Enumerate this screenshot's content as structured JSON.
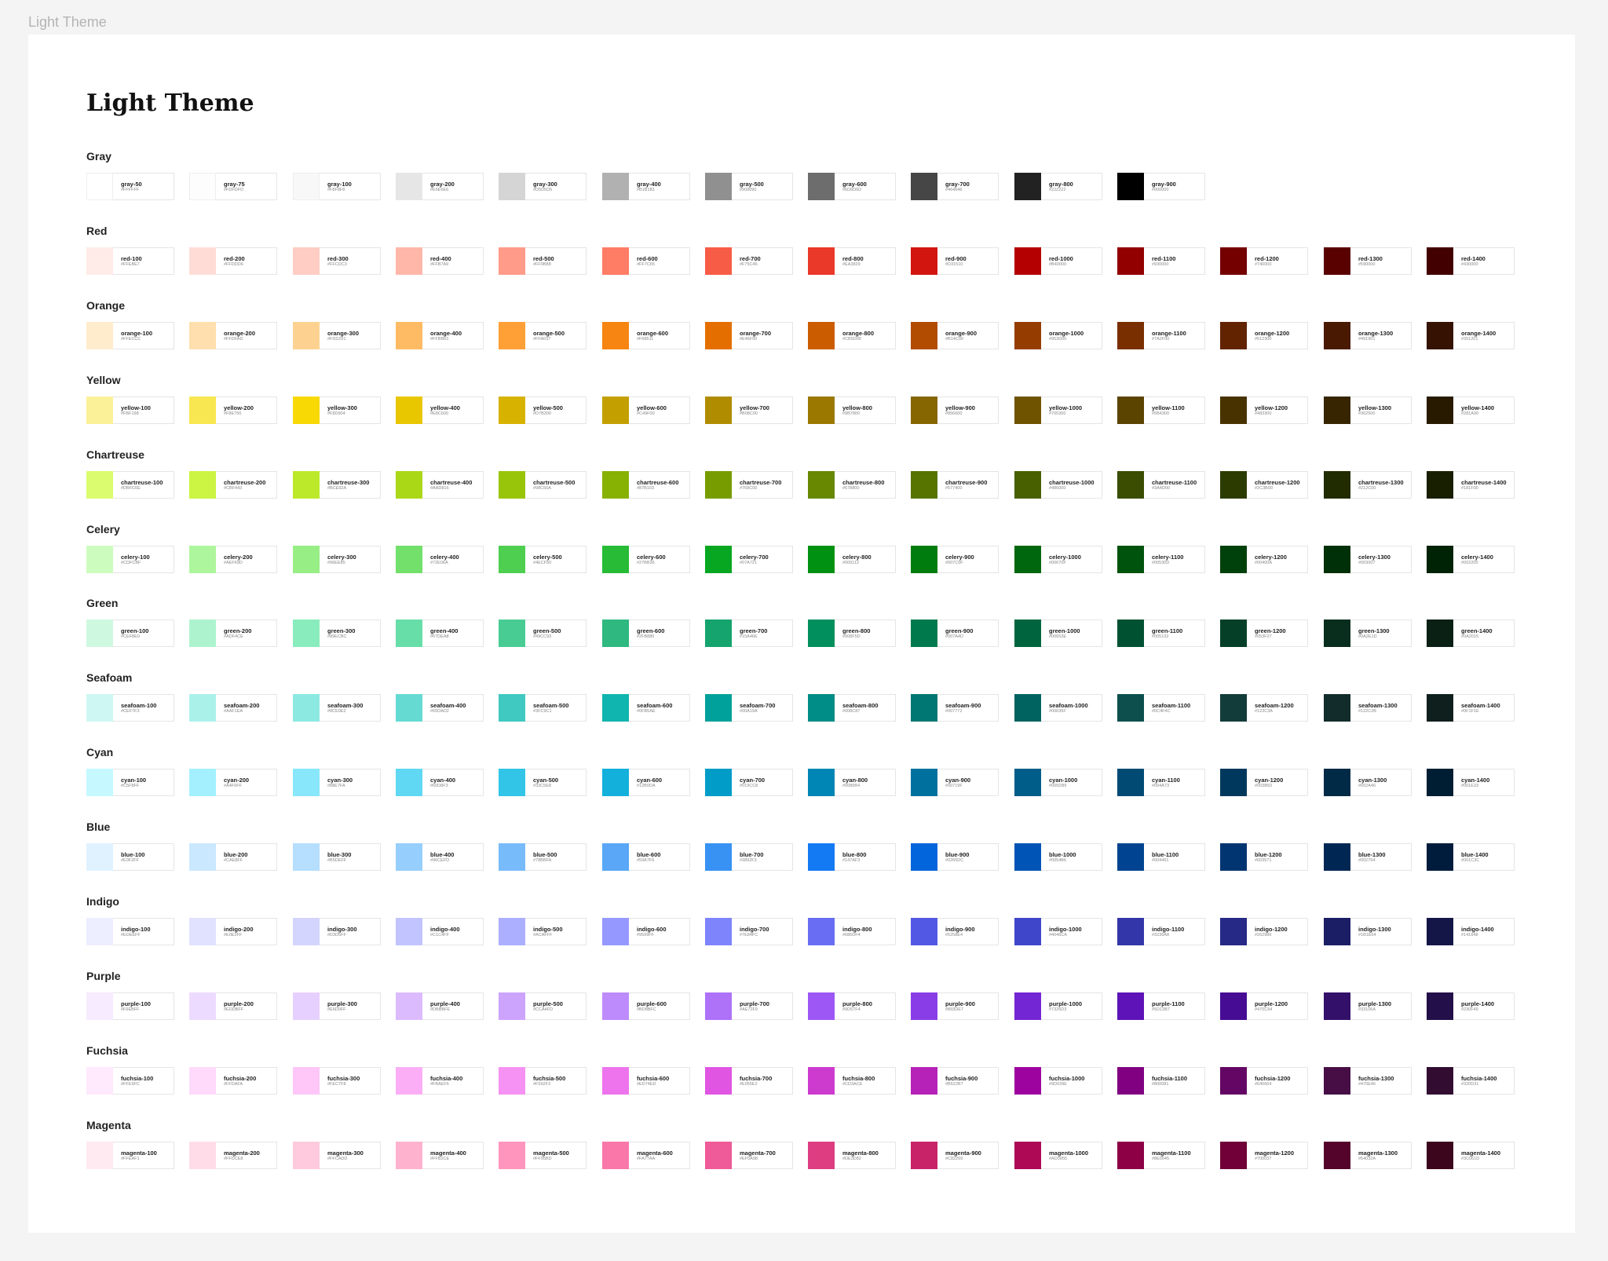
{
  "frame_label": "Light Theme",
  "title": "Light Theme",
  "groups": [
    {
      "name": "Gray",
      "swatches": [
        {
          "name": "gray-50",
          "hex": "#FFFFFF"
        },
        {
          "name": "gray-75",
          "hex": "#FDFDFD"
        },
        {
          "name": "gray-100",
          "hex": "#F8F8F8"
        },
        {
          "name": "gray-200",
          "hex": "#E6E6E6"
        },
        {
          "name": "gray-300",
          "hex": "#D5D5D5"
        },
        {
          "name": "gray-400",
          "hex": "#B1B1B1"
        },
        {
          "name": "gray-500",
          "hex": "#909090"
        },
        {
          "name": "gray-600",
          "hex": "#6D6D6D"
        },
        {
          "name": "gray-700",
          "hex": "#464646"
        },
        {
          "name": "gray-800",
          "hex": "#222222"
        },
        {
          "name": "gray-900",
          "hex": "#000000"
        }
      ]
    },
    {
      "name": "Red",
      "swatches": [
        {
          "name": "red-100",
          "hex": "#FFEBE7"
        },
        {
          "name": "red-200",
          "hex": "#FFDDD6"
        },
        {
          "name": "red-300",
          "hex": "#FFCDC3"
        },
        {
          "name": "red-400",
          "hex": "#FFB7A9"
        },
        {
          "name": "red-500",
          "hex": "#FF9B88"
        },
        {
          "name": "red-600",
          "hex": "#FF7C65"
        },
        {
          "name": "red-700",
          "hex": "#F75C46"
        },
        {
          "name": "red-800",
          "hex": "#EA3829"
        },
        {
          "name": "red-900",
          "hex": "#D31510"
        },
        {
          "name": "red-1000",
          "hex": "#B40000"
        },
        {
          "name": "red-1100",
          "hex": "#930000"
        },
        {
          "name": "red-1200",
          "hex": "#740000"
        },
        {
          "name": "red-1300",
          "hex": "#590000"
        },
        {
          "name": "red-1400",
          "hex": "#430000"
        }
      ]
    },
    {
      "name": "Orange",
      "swatches": [
        {
          "name": "orange-100",
          "hex": "#FFECCC"
        },
        {
          "name": "orange-200",
          "hex": "#FFDFAD"
        },
        {
          "name": "orange-300",
          "hex": "#FDD291"
        },
        {
          "name": "orange-400",
          "hex": "#FFBB63"
        },
        {
          "name": "orange-500",
          "hex": "#FFA037"
        },
        {
          "name": "orange-600",
          "hex": "#F68511"
        },
        {
          "name": "orange-700",
          "hex": "#E46F00"
        },
        {
          "name": "orange-800",
          "hex": "#CB5D00"
        },
        {
          "name": "orange-900",
          "hex": "#B14C00"
        },
        {
          "name": "orange-1000",
          "hex": "#953D00"
        },
        {
          "name": "orange-1100",
          "hex": "#7A2F00"
        },
        {
          "name": "orange-1200",
          "hex": "#612300"
        },
        {
          "name": "orange-1300",
          "hex": "#491901"
        },
        {
          "name": "orange-1400",
          "hex": "#351201"
        }
      ]
    },
    {
      "name": "Yellow",
      "swatches": [
        {
          "name": "yellow-100",
          "hex": "#FBF198"
        },
        {
          "name": "yellow-200",
          "hex": "#F8E750"
        },
        {
          "name": "yellow-300",
          "hex": "#F8D904"
        },
        {
          "name": "yellow-400",
          "hex": "#E8C600"
        },
        {
          "name": "yellow-500",
          "hex": "#D7B300"
        },
        {
          "name": "yellow-600",
          "hex": "#C49F00"
        },
        {
          "name": "yellow-700",
          "hex": "#B08C00"
        },
        {
          "name": "yellow-800",
          "hex": "#9B7800"
        },
        {
          "name": "yellow-900",
          "hex": "#856600"
        },
        {
          "name": "yellow-1000",
          "hex": "#705300"
        },
        {
          "name": "yellow-1100",
          "hex": "#5B4300"
        },
        {
          "name": "yellow-1200",
          "hex": "#483300"
        },
        {
          "name": "yellow-1300",
          "hex": "#362500"
        },
        {
          "name": "yellow-1400",
          "hex": "#281A00"
        }
      ]
    },
    {
      "name": "Chartreuse",
      "swatches": [
        {
          "name": "chartreuse-100",
          "hex": "#DBFC6E"
        },
        {
          "name": "chartreuse-200",
          "hex": "#CBF443"
        },
        {
          "name": "chartreuse-300",
          "hex": "#BCE92A"
        },
        {
          "name": "chartreuse-400",
          "hex": "#AAD816"
        },
        {
          "name": "chartreuse-500",
          "hex": "#98C50A"
        },
        {
          "name": "chartreuse-600",
          "hex": "#87B103"
        },
        {
          "name": "chartreuse-700",
          "hex": "#769C00"
        },
        {
          "name": "chartreuse-800",
          "hex": "#678800"
        },
        {
          "name": "chartreuse-900",
          "hex": "#577400"
        },
        {
          "name": "chartreuse-1000",
          "hex": "#486000"
        },
        {
          "name": "chartreuse-1100",
          "hex": "#3A4D00"
        },
        {
          "name": "chartreuse-1200",
          "hex": "#2C3B00"
        },
        {
          "name": "chartreuse-1300",
          "hex": "#212C00"
        },
        {
          "name": "chartreuse-1400",
          "hex": "#181F00"
        }
      ]
    },
    {
      "name": "Celery",
      "swatches": [
        {
          "name": "celery-100",
          "hex": "#CDFCBF"
        },
        {
          "name": "celery-200",
          "hex": "#AEF69D"
        },
        {
          "name": "celery-300",
          "hex": "#96EE85"
        },
        {
          "name": "celery-400",
          "hex": "#72E06A"
        },
        {
          "name": "celery-500",
          "hex": "#4ECF50"
        },
        {
          "name": "celery-600",
          "hex": "#27BB36"
        },
        {
          "name": "celery-700",
          "hex": "#07A721"
        },
        {
          "name": "celery-800",
          "hex": "#009112"
        },
        {
          "name": "celery-900",
          "hex": "#007C0F"
        },
        {
          "name": "celery-1000",
          "hex": "#00670F"
        },
        {
          "name": "celery-1100",
          "hex": "#00530D"
        },
        {
          "name": "celery-1200",
          "hex": "#00400A"
        },
        {
          "name": "celery-1300",
          "hex": "#003007"
        },
        {
          "name": "celery-1400",
          "hex": "#002205"
        }
      ]
    },
    {
      "name": "Green",
      "swatches": [
        {
          "name": "green-100",
          "hex": "#CEF8E0"
        },
        {
          "name": "green-200",
          "hex": "#ADF4CE"
        },
        {
          "name": "green-300",
          "hex": "#89ECBC"
        },
        {
          "name": "green-400",
          "hex": "#67DEA8"
        },
        {
          "name": "green-500",
          "hex": "#49CC93"
        },
        {
          "name": "green-600",
          "hex": "#2FB880"
        },
        {
          "name": "green-700",
          "hex": "#15A46E"
        },
        {
          "name": "green-800",
          "hex": "#008F5D"
        },
        {
          "name": "green-900",
          "hex": "#007A4D"
        },
        {
          "name": "green-1000",
          "hex": "#00653E"
        },
        {
          "name": "green-1100",
          "hex": "#005132"
        },
        {
          "name": "green-1200",
          "hex": "#053F27"
        },
        {
          "name": "green-1300",
          "hex": "#0A2E1D"
        },
        {
          "name": "green-1400",
          "hex": "#0A2015"
        }
      ]
    },
    {
      "name": "Seafoam",
      "swatches": [
        {
          "name": "seafoam-100",
          "hex": "#CEF7F3"
        },
        {
          "name": "seafoam-200",
          "hex": "#AAF1EA"
        },
        {
          "name": "seafoam-300",
          "hex": "#8CE9E2"
        },
        {
          "name": "seafoam-400",
          "hex": "#65DAD2"
        },
        {
          "name": "seafoam-500",
          "hex": "#3FC9C1"
        },
        {
          "name": "seafoam-600",
          "hex": "#0FB5AE"
        },
        {
          "name": "seafoam-700",
          "hex": "#00A19A"
        },
        {
          "name": "seafoam-800",
          "hex": "#008C87"
        },
        {
          "name": "seafoam-900",
          "hex": "#007772"
        },
        {
          "name": "seafoam-1000",
          "hex": "#00635F"
        },
        {
          "name": "seafoam-1100",
          "hex": "#0C4F4C"
        },
        {
          "name": "seafoam-1200",
          "hex": "#123C3A"
        },
        {
          "name": "seafoam-1300",
          "hex": "#122C2B"
        },
        {
          "name": "seafoam-1400",
          "hex": "#0F1F1E"
        }
      ]
    },
    {
      "name": "Cyan",
      "swatches": [
        {
          "name": "cyan-100",
          "hex": "#C5F8FF"
        },
        {
          "name": "cyan-200",
          "hex": "#A4F0FF"
        },
        {
          "name": "cyan-300",
          "hex": "#88E7FA"
        },
        {
          "name": "cyan-400",
          "hex": "#60D8F3"
        },
        {
          "name": "cyan-500",
          "hex": "#33C5E8"
        },
        {
          "name": "cyan-600",
          "hex": "#12B0DA"
        },
        {
          "name": "cyan-700",
          "hex": "#019CC8"
        },
        {
          "name": "cyan-800",
          "hex": "#0086B4"
        },
        {
          "name": "cyan-900",
          "hex": "#00719F"
        },
        {
          "name": "cyan-1000",
          "hex": "#005D89"
        },
        {
          "name": "cyan-1100",
          "hex": "#004A73"
        },
        {
          "name": "cyan-1200",
          "hex": "#00385D"
        },
        {
          "name": "cyan-1300",
          "hex": "#002A46"
        },
        {
          "name": "cyan-1400",
          "hex": "#001E33"
        }
      ]
    },
    {
      "name": "Blue",
      "swatches": [
        {
          "name": "blue-100",
          "hex": "#E0F2FF"
        },
        {
          "name": "blue-200",
          "hex": "#CAE8FF"
        },
        {
          "name": "blue-300",
          "hex": "#B5DEFF"
        },
        {
          "name": "blue-400",
          "hex": "#96CEFD"
        },
        {
          "name": "blue-500",
          "hex": "#78BBFA"
        },
        {
          "name": "blue-600",
          "hex": "#59A7F6"
        },
        {
          "name": "blue-700",
          "hex": "#3892F3"
        },
        {
          "name": "blue-800",
          "hex": "#147AF3"
        },
        {
          "name": "blue-900",
          "hex": "#0265DC"
        },
        {
          "name": "blue-1000",
          "hex": "#0054B6"
        },
        {
          "name": "blue-1100",
          "hex": "#004491"
        },
        {
          "name": "blue-1200",
          "hex": "#003571"
        },
        {
          "name": "blue-1300",
          "hex": "#002754"
        },
        {
          "name": "blue-1400",
          "hex": "#001C3C"
        }
      ]
    },
    {
      "name": "Indigo",
      "swatches": [
        {
          "name": "indigo-100",
          "hex": "#EDEEFF"
        },
        {
          "name": "indigo-200",
          "hex": "#E0E2FF"
        },
        {
          "name": "indigo-300",
          "hex": "#D3D5FF"
        },
        {
          "name": "indigo-400",
          "hex": "#C1C4FF"
        },
        {
          "name": "indigo-500",
          "hex": "#ACAFFF"
        },
        {
          "name": "indigo-600",
          "hex": "#9599FF"
        },
        {
          "name": "indigo-700",
          "hex": "#7E84FC"
        },
        {
          "name": "indigo-800",
          "hex": "#686DF4"
        },
        {
          "name": "indigo-900",
          "hex": "#5258E4"
        },
        {
          "name": "indigo-1000",
          "hex": "#4046CA"
        },
        {
          "name": "indigo-1100",
          "hex": "#3236A8"
        },
        {
          "name": "indigo-1200",
          "hex": "#262986"
        },
        {
          "name": "indigo-1300",
          "hex": "#1B1E64"
        },
        {
          "name": "indigo-1400",
          "hex": "#141648"
        }
      ]
    },
    {
      "name": "Purple",
      "swatches": [
        {
          "name": "purple-100",
          "hex": "#F6EBFF"
        },
        {
          "name": "purple-200",
          "hex": "#EDDBFF"
        },
        {
          "name": "purple-300",
          "hex": "#E6D0FF"
        },
        {
          "name": "purple-400",
          "hex": "#DBBBFE"
        },
        {
          "name": "purple-500",
          "hex": "#CCA4FD"
        },
        {
          "name": "purple-600",
          "hex": "#BD8BFC"
        },
        {
          "name": "purple-700",
          "hex": "#AE72F9"
        },
        {
          "name": "purple-800",
          "hex": "#9D57F4"
        },
        {
          "name": "purple-900",
          "hex": "#893DE7"
        },
        {
          "name": "purple-1000",
          "hex": "#7326D3"
        },
        {
          "name": "purple-1100",
          "hex": "#5D13B7"
        },
        {
          "name": "purple-1200",
          "hex": "#470C94"
        },
        {
          "name": "purple-1300",
          "hex": "#33106A"
        },
        {
          "name": "purple-1400",
          "hex": "#230F49"
        }
      ]
    },
    {
      "name": "Fuchsia",
      "swatches": [
        {
          "name": "fuchsia-100",
          "hex": "#FFE9FC"
        },
        {
          "name": "fuchsia-200",
          "hex": "#FFDAFA"
        },
        {
          "name": "fuchsia-300",
          "hex": "#FEC7F8"
        },
        {
          "name": "fuchsia-400",
          "hex": "#FBAEF6"
        },
        {
          "name": "fuchsia-500",
          "hex": "#F592F3"
        },
        {
          "name": "fuchsia-600",
          "hex": "#ED74ED"
        },
        {
          "name": "fuchsia-700",
          "hex": "#E055E2"
        },
        {
          "name": "fuchsia-800",
          "hex": "#CD3ACE"
        },
        {
          "name": "fuchsia-900",
          "hex": "#B622B7"
        },
        {
          "name": "fuchsia-1000",
          "hex": "#9D039E"
        },
        {
          "name": "fuchsia-1100",
          "hex": "#800081"
        },
        {
          "name": "fuchsia-1200",
          "hex": "#640664"
        },
        {
          "name": "fuchsia-1300",
          "hex": "#470E46"
        },
        {
          "name": "fuchsia-1400",
          "hex": "#320D31"
        }
      ]
    },
    {
      "name": "Magenta",
      "swatches": [
        {
          "name": "magenta-100",
          "hex": "#FFEAF1"
        },
        {
          "name": "magenta-200",
          "hex": "#FFDCE8"
        },
        {
          "name": "magenta-300",
          "hex": "#FFCADD"
        },
        {
          "name": "magenta-400",
          "hex": "#FFB2CE"
        },
        {
          "name": "magenta-500",
          "hex": "#FF95BD"
        },
        {
          "name": "magenta-600",
          "hex": "#FA77AA"
        },
        {
          "name": "magenta-700",
          "hex": "#EF5A98"
        },
        {
          "name": "magenta-800",
          "hex": "#DE3D82"
        },
        {
          "name": "magenta-900",
          "hex": "#C82269"
        },
        {
          "name": "magenta-1000",
          "hex": "#AD0955"
        },
        {
          "name": "magenta-1100",
          "hex": "#8E0045"
        },
        {
          "name": "magenta-1200",
          "hex": "#700037"
        },
        {
          "name": "magenta-1300",
          "hex": "#54032A"
        },
        {
          "name": "magenta-1400",
          "hex": "#3C061D"
        }
      ]
    }
  ]
}
